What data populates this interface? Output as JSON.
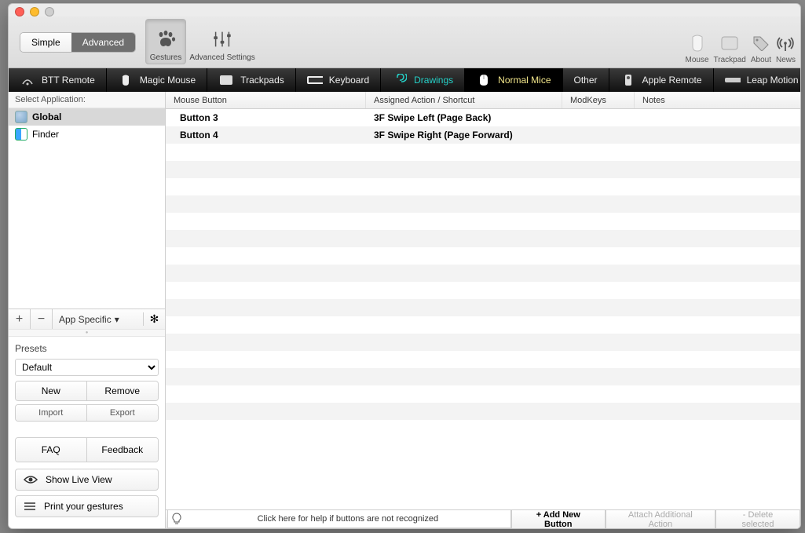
{
  "toolbar": {
    "mode": {
      "simple": "Simple",
      "advanced": "Advanced",
      "active": "advanced"
    },
    "gestures": "Gestures",
    "advanced_settings": "Advanced Settings",
    "right": {
      "mouse": "Mouse",
      "trackpad": "Trackpad",
      "about": "About",
      "news": "News"
    }
  },
  "device_tabs": [
    {
      "id": "btt",
      "label": "BTT Remote"
    },
    {
      "id": "magicmouse",
      "label": "Magic Mouse"
    },
    {
      "id": "trackpads",
      "label": "Trackpads"
    },
    {
      "id": "keyboard",
      "label": "Keyboard"
    },
    {
      "id": "drawings",
      "label": "Drawings"
    },
    {
      "id": "normalmice",
      "label": "Normal Mice",
      "active": true
    },
    {
      "id": "other",
      "label": "Other"
    },
    {
      "id": "appleremote",
      "label": "Apple Remote"
    },
    {
      "id": "leapmotion",
      "label": "Leap Motion"
    }
  ],
  "sidebar": {
    "header": "Select Application:",
    "apps": [
      {
        "id": "global",
        "label": "Global",
        "selected": true
      },
      {
        "id": "finder",
        "label": "Finder"
      }
    ],
    "app_specific": "App Specific",
    "presets": {
      "title": "Presets",
      "selected": "Default",
      "new": "New",
      "remove": "Remove",
      "import": "Import",
      "export": "Export"
    },
    "faq": "FAQ",
    "feedback": "Feedback",
    "live_view": "Show Live View",
    "print": "Print your gestures"
  },
  "table": {
    "headers": {
      "button": "Mouse Button",
      "action": "Assigned Action / Shortcut",
      "mod": "ModKeys",
      "notes": "Notes"
    },
    "rows": [
      {
        "button": "Button 3",
        "action": "3F Swipe Left (Page Back)"
      },
      {
        "button": "Button 4",
        "action": "3F Swipe Right (Page Forward)"
      }
    ]
  },
  "bottom": {
    "help": "Click here for help if buttons are not recognized",
    "add": "+ Add New Button",
    "attach": "Attach Additional Action",
    "delete": "- Delete selected"
  }
}
